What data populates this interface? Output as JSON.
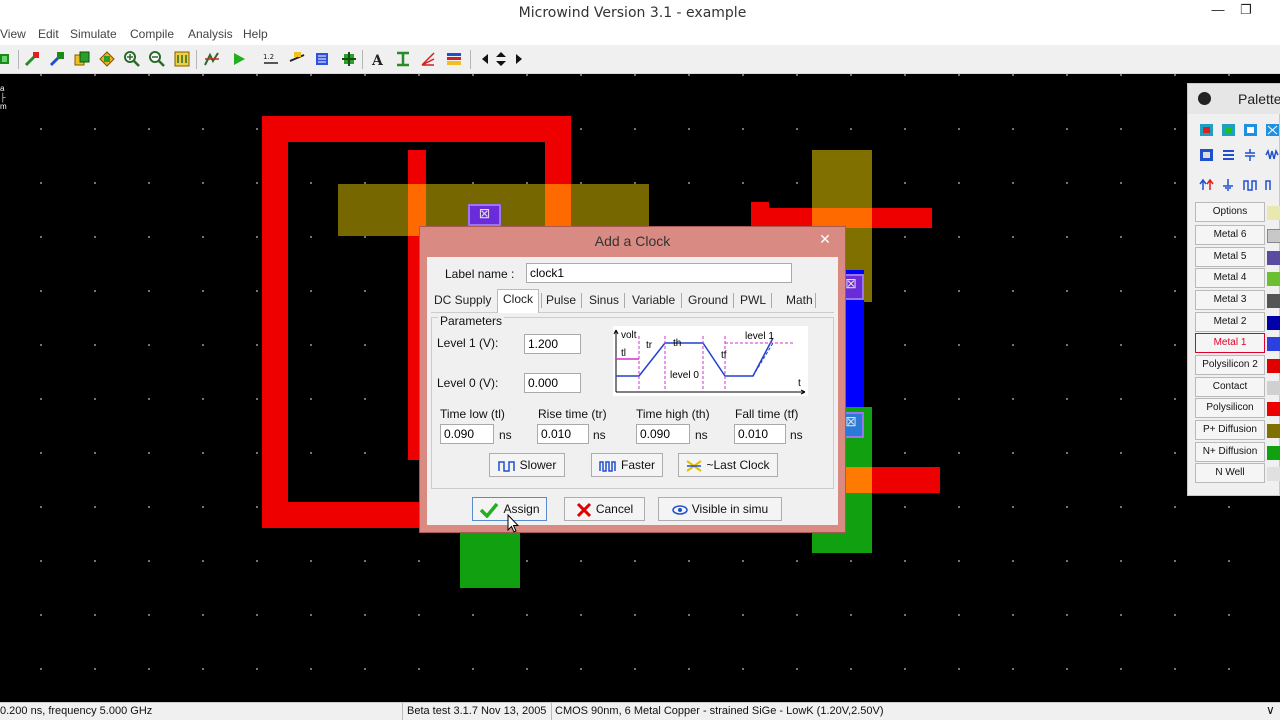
{
  "window": {
    "title": "Microwind Version 3.1 - example"
  },
  "menu": [
    "View",
    "Edit",
    "Simulate",
    "Compile",
    "Analysis",
    "Help"
  ],
  "canvas": {
    "ruler_fragment": "a"
  },
  "palette": {
    "title": "Palette",
    "layers": [
      {
        "label": "Options",
        "color": "#e8e8b0"
      },
      {
        "label": "Metal 6",
        "color": "#9a9a9a"
      },
      {
        "label": "Metal 5",
        "color": "#5a4aa0"
      },
      {
        "label": "Metal 4",
        "color": "#6cbf30"
      },
      {
        "label": "Metal 3",
        "color": "#555555"
      },
      {
        "label": "Metal 2",
        "color": "#0000aa"
      },
      {
        "label": "Metal 1",
        "color": "#2a40e0",
        "active": true
      },
      {
        "label": "Polysilicon 2",
        "color": "#e00000"
      },
      {
        "label": "Contact",
        "color": "#d0d0d0"
      },
      {
        "label": "Polysilicon",
        "color": "#ee0000"
      },
      {
        "label": "P+ Diffusion",
        "color": "#807000"
      },
      {
        "label": "N+ Diffusion",
        "color": "#10a010"
      },
      {
        "label": "N Well",
        "color": "#e0e0e0"
      }
    ]
  },
  "dialog": {
    "title": "Add a Clock",
    "label_name_label": "Label name :",
    "label_name_value": "clock1",
    "tabs": [
      "DC Supply",
      "Clock",
      "Pulse",
      "Sinus",
      "Variable",
      "Ground",
      "PWL",
      "Math"
    ],
    "selected_tab": "Clock",
    "parameters_label": "Parameters",
    "level1_label": "Level 1 (V):",
    "level1_value": "1.200",
    "level0_label": "Level 0 (V):",
    "level0_value": "0.000",
    "time_low_label": "Time low (tl)",
    "time_low_value": "0.090",
    "rise_time_label": "Rise time (tr)",
    "rise_time_value": "0.010",
    "time_high_label": "Time high (th)",
    "time_high_value": "0.090",
    "fall_time_label": "Fall time (tf)",
    "fall_time_value": "0.010",
    "unit": "ns",
    "diagram": {
      "volt": "volt",
      "tl": "tl",
      "tr": "tr",
      "th": "th",
      "tf": "tf",
      "level1": "level 1",
      "level0": "level 0",
      "t": "t"
    },
    "slower_label": "Slower",
    "faster_label": "Faster",
    "last_clock_label": "~Last Clock",
    "assign_label": "Assign",
    "cancel_label": "Cancel",
    "visible_label": "Visible in simu"
  },
  "status": {
    "left": "0.200 ns, frequency 5.000 GHz",
    "version": "Beta test 3.1.7 Nov 13, 2005",
    "tech": "CMOS 90nm, 6 Metal Copper - strained SiGe - LowK (1.20V,2.50V)"
  },
  "colors": {
    "poly": "#ee0000",
    "pdiff": "#807000",
    "ndiff": "#10a010",
    "metal1": "#0000ff",
    "contact": "#6a2bd8",
    "dialog_frame": "#d98b83"
  }
}
